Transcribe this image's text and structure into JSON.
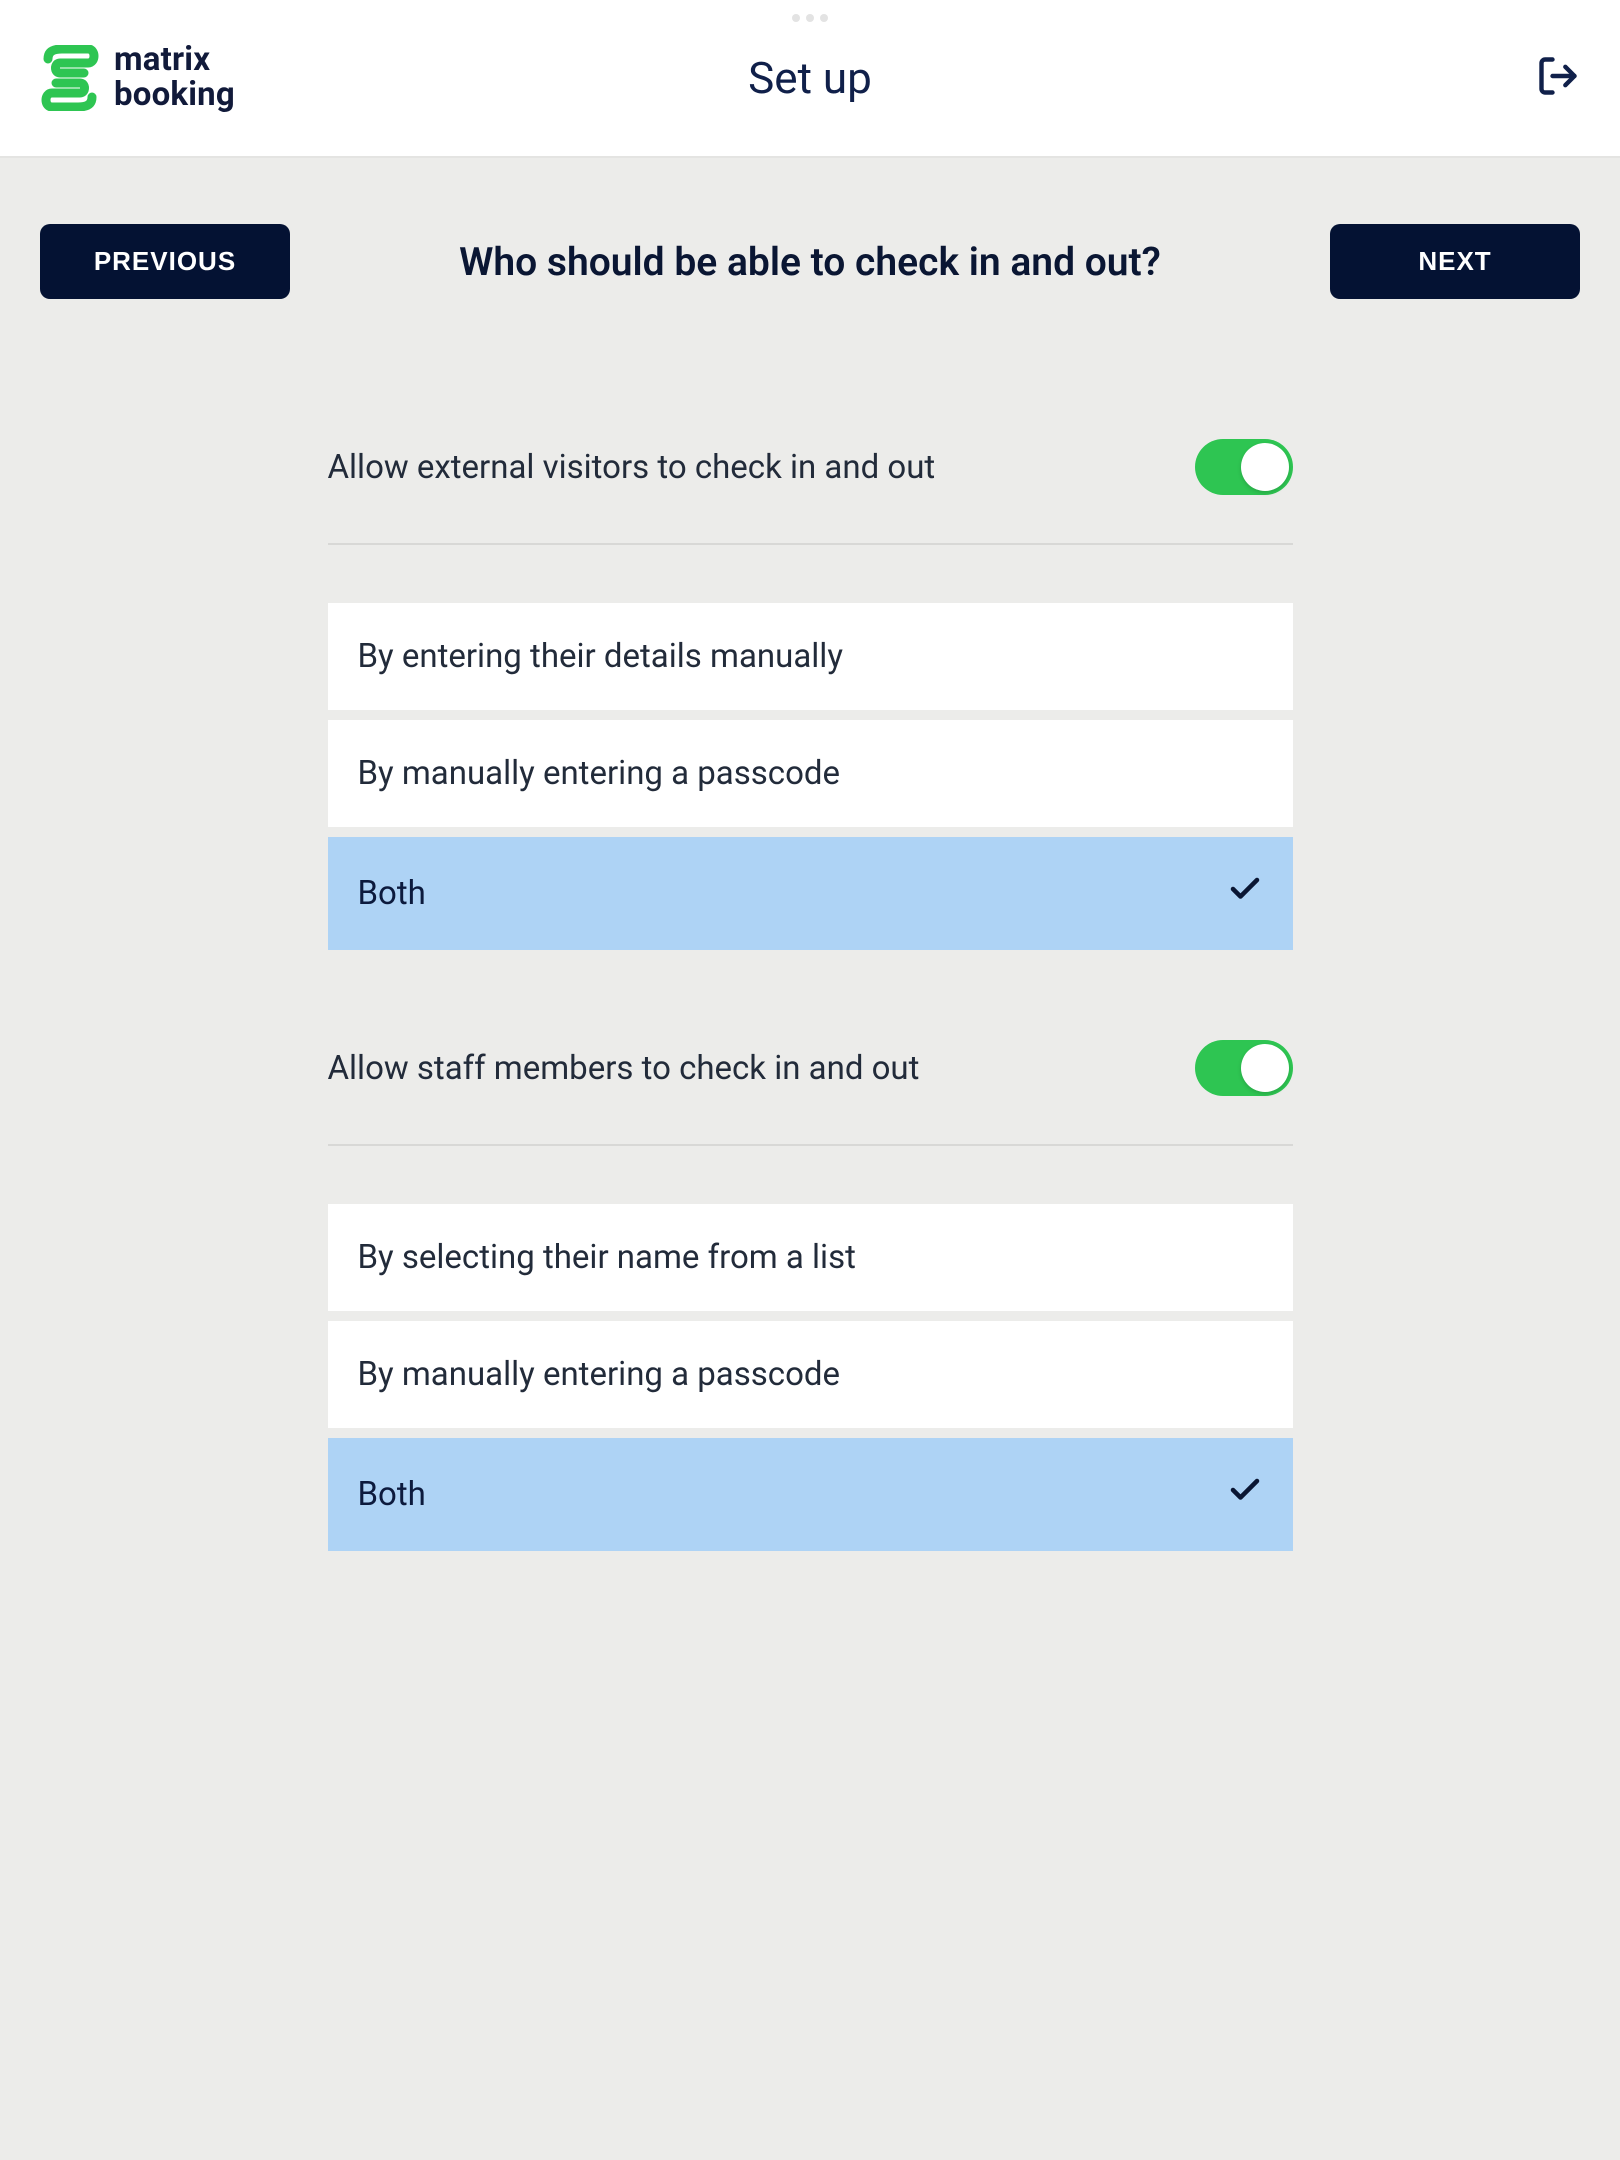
{
  "brand": {
    "line1": "matrix",
    "line2": "booking"
  },
  "header": {
    "title": "Set up"
  },
  "nav": {
    "previous": "PREVIOUS",
    "next": "NEXT"
  },
  "question": "Who should be able to check in and out?",
  "sections": {
    "visitors": {
      "label": "Allow external visitors to check in and out",
      "toggle_on": true,
      "options": [
        {
          "label": "By entering their details manually",
          "selected": false
        },
        {
          "label": "By manually entering a passcode",
          "selected": false
        },
        {
          "label": "Both",
          "selected": true
        }
      ]
    },
    "staff": {
      "label": "Allow staff members to check in and out",
      "toggle_on": true,
      "options": [
        {
          "label": "By selecting their name from a list",
          "selected": false
        },
        {
          "label": "By manually entering a passcode",
          "selected": false
        },
        {
          "label": "Both",
          "selected": true
        }
      ]
    }
  },
  "colors": {
    "brand_green": "#2ec552",
    "brand_dark": "#041233",
    "selected_blue": "#aed3f5",
    "bg": "#ececea"
  }
}
